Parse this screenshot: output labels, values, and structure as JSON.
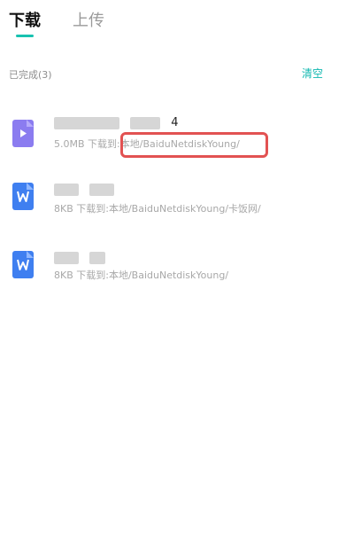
{
  "tabs": {
    "download": "下载",
    "upload": "上传"
  },
  "section": {
    "label": "已完成(3)",
    "clear_label": "清空"
  },
  "files": [
    {
      "icon": "video-file-icon",
      "name_visible": "4",
      "meta": "5.0MB 下载到:本地/BaiduNetdiskYoung/"
    },
    {
      "icon": "word-file-icon",
      "meta": "8KB 下载到:本地/BaiduNetdiskYoung/卡饭网/"
    },
    {
      "icon": "word-file-icon",
      "meta": "8KB 下载到:本地/BaiduNetdiskYoung/"
    }
  ],
  "colors": {
    "accent": "#18c2b0",
    "clear_text": "#11b8b0",
    "video_icon": "#8b7cf0",
    "word_icon": "#3f7ff0",
    "highlight": "#e25252"
  }
}
